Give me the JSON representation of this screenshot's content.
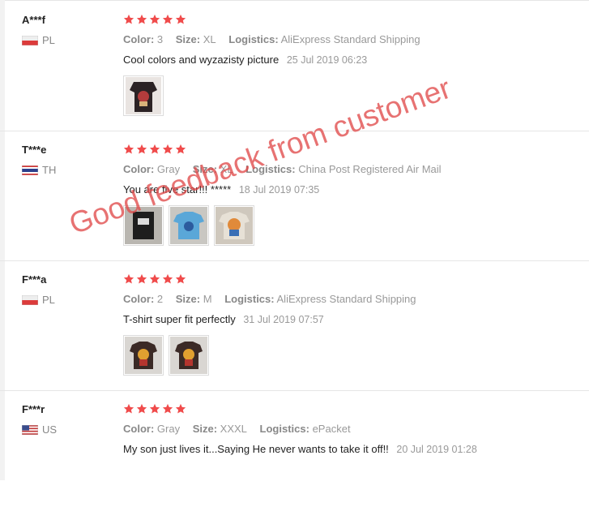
{
  "labels": {
    "color": "Color:",
    "size": "Size:",
    "logistics": "Logistics:"
  },
  "reviews": [
    {
      "user": "A***f",
      "country": "PL",
      "color": "3",
      "size": "XL",
      "logistics": "AliExpress Standard Shipping",
      "comment": "Cool colors and wyzazisty picture",
      "date": "25 Jul 2019 06:23",
      "rating": 5,
      "photos": 1
    },
    {
      "user": "T***e",
      "country": "TH",
      "color": "Gray",
      "size": "XL",
      "logistics": "China Post Registered Air Mail",
      "comment": "You are five star!!! *****",
      "date": "18 Jul 2019 07:35",
      "rating": 5,
      "photos": 3
    },
    {
      "user": "F***a",
      "country": "PL",
      "color": "2",
      "size": "M",
      "logistics": "AliExpress Standard Shipping",
      "comment": "T-shirt super fit perfectly",
      "date": "31 Jul 2019 07:57",
      "rating": 5,
      "photos": 2
    },
    {
      "user": "F***r",
      "country": "US",
      "color": "Gray",
      "size": "XXXL",
      "logistics": "ePacket",
      "comment": "My son just lives it...Saying He never wants to take it off!!",
      "date": "20 Jul 2019 01:28",
      "rating": 5,
      "photos": 0
    }
  ],
  "watermark": "Good feedback from customer",
  "colors": {
    "star": "#f04b4b",
    "watermark": "#e04a4a"
  }
}
